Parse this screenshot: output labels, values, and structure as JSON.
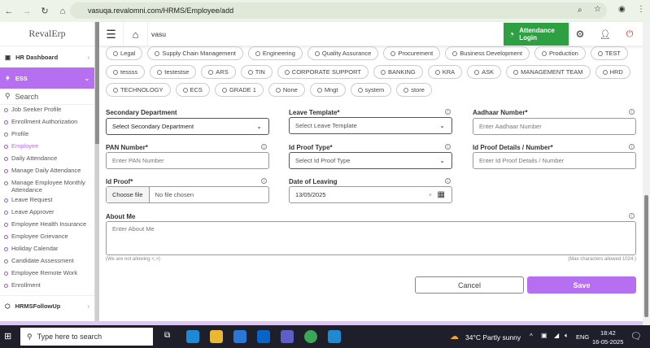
{
  "browser": {
    "url": "vasuqa.revalomni.com/HRMS/Employee/add"
  },
  "sidebar": {
    "logo": "RevalErp",
    "hr_dashboard": "HR Dashboard",
    "ess": "ESS",
    "search": "Search",
    "items": [
      "Job Seeker Profile",
      "Enrollment Authorization",
      "Profile",
      "Employee",
      "Daily Attendance",
      "Manage Daily Attendance",
      "Manage Employee Monthly Attendance",
      "Leave Request",
      "Leave Approver",
      "Employee Health Insurance",
      "Employee Grievance",
      "Holiday Calendar",
      "Candidate Assessment",
      "Employee Remote Work",
      "Enrollment"
    ],
    "active_item": "Employee",
    "followup": "HRMSFollowUp"
  },
  "header": {
    "company": "vasu",
    "attendance_label": "Attendance Login"
  },
  "departments": [
    [
      "Legal",
      "Supply Chain Management",
      "Engineering",
      "Quality Assurance",
      "Procurement",
      "Business Development",
      "Production",
      "TEST"
    ],
    [
      "tessss",
      "testestse",
      "ARS",
      "TIN",
      "CORPORATE SUPPORT",
      "BANKING",
      "KRA",
      "ASK",
      "MANAGEMENT TEAM",
      "HRD"
    ],
    [
      "TECHNOLOGY",
      "ECS",
      "GRADE 1",
      "None",
      "Mngt",
      "system",
      "store"
    ]
  ],
  "form": {
    "secondary_department": {
      "label": "Secondary Department",
      "value": "Select Secondary Department"
    },
    "leave_template": {
      "label": "Leave Template*",
      "placeholder": "Select Leave Template"
    },
    "aadhaar": {
      "label": "Aadhaar Number*",
      "placeholder": "Enter Aadhaar Number"
    },
    "pan": {
      "label": "PAN Number*",
      "placeholder": "Enter PAN Number"
    },
    "id_proof_type": {
      "label": "Id Proof Type*",
      "placeholder": "Select Id Proof Type"
    },
    "id_proof_details": {
      "label": "Id Proof Details / Number*",
      "placeholder": "Enter Id Proof Details / Number"
    },
    "id_proof": {
      "label": "Id Proof*",
      "button": "Choose file",
      "status": "No file chosen"
    },
    "date_of_leaving": {
      "label": "Date of Leaving",
      "value": "13/05/2025"
    },
    "about_me": {
      "label": "About Me",
      "placeholder": "Enter About Me",
      "hint_left": "(We are not allowing <,>)",
      "hint_right": "(Max characters allowed 1024.)"
    },
    "cancel": "Cancel",
    "save": "Save"
  },
  "taskbar": {
    "search": "Type here to search",
    "weather": "34°C  Partly sunny",
    "lang": "ENG",
    "time": "18:42",
    "date": "16-05-2025"
  },
  "colors": {
    "accent": "#b66ff0",
    "attendance": "#2ea043"
  }
}
